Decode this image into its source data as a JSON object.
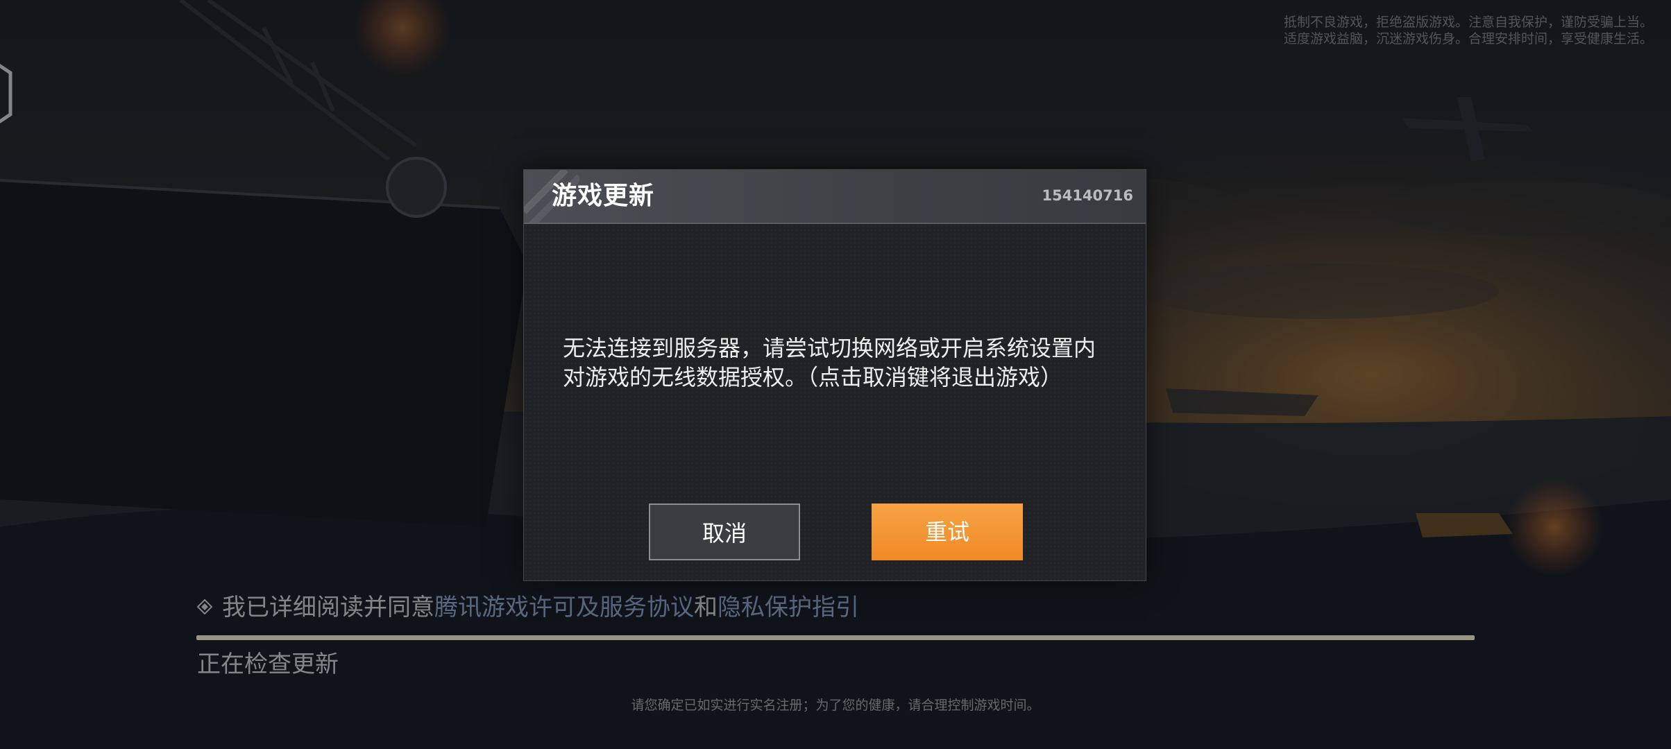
{
  "health_notice": {
    "line1": "抵制不良游戏，拒绝盗版游戏。注意自我保护，谨防受骗上当。",
    "line2": "适度游戏益脑，沉迷游戏伤身。合理安排时间，享受健康生活。"
  },
  "dialog": {
    "title": "游戏更新",
    "code": "154140716",
    "message_line1": "无法连接到服务器，请尝试切换网络或开启系统设置内",
    "message_line2": "对游戏的无线数据授权。（点击取消键将退出游戏）",
    "cancel_label": "取消",
    "retry_label": "重试"
  },
  "launcher": {
    "agreement_prefix": "我已详细阅读并同意",
    "agreement_link1": "腾讯游戏许可及服务协议",
    "agreement_and": "和",
    "agreement_link2": "隐私保护指引",
    "status": "正在检查更新",
    "progress": 1.0
  },
  "bottom_notice": "请您确定已如实进行实名注册；为了您的健康，请合理控制游戏时间。",
  "colors": {
    "accent_orange": "#f08a26",
    "dialog_bg": "#202225",
    "header_bg": "#4b4f55"
  }
}
